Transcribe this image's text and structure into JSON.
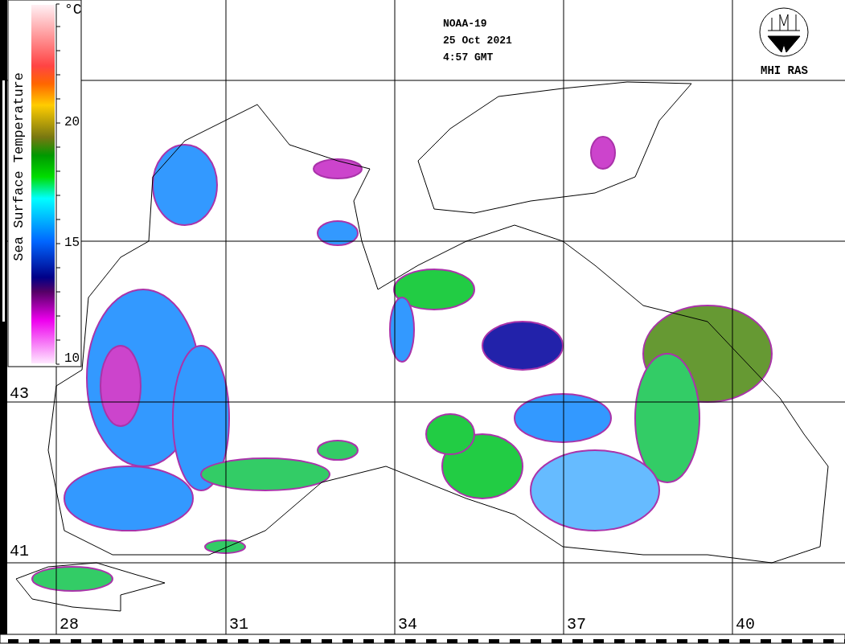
{
  "header": {
    "satellite": "NOAA-19",
    "date": "25 Oct 2021",
    "time": "4:57 GMT"
  },
  "logo": {
    "label": "MHI RAS"
  },
  "colorbar": {
    "title": "Sea Surface Temperature",
    "unit": "°C",
    "tick_labels": [
      "20",
      "15",
      "10"
    ]
  },
  "latitude_labels": [
    "43",
    "41"
  ],
  "longitude_labels": [
    "28",
    "31",
    "34",
    "37",
    "40"
  ]
}
